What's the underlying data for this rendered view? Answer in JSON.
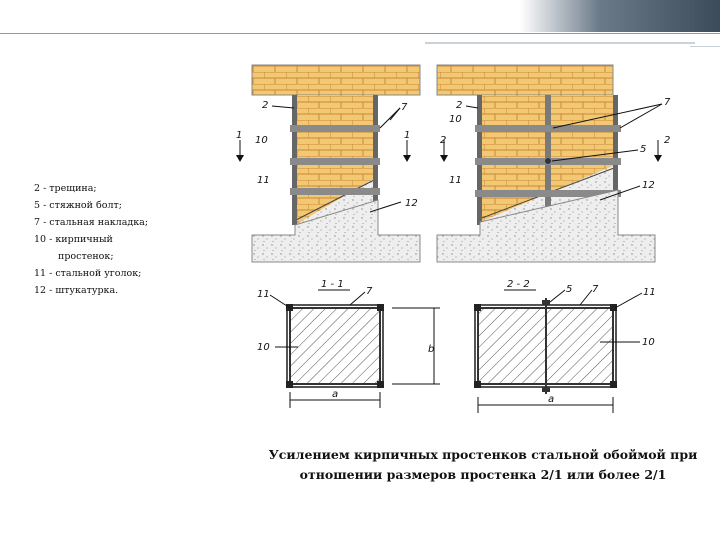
{
  "legend": [
    {
      "num": "2",
      "text": "2 - трещина;"
    },
    {
      "num": "5",
      "text": "5 - стяжной болт;"
    },
    {
      "num": "7",
      "text": "7 - стальная накладка;"
    },
    {
      "num": "10",
      "text": "10 - кирпичный",
      "cont": "простенок;"
    },
    {
      "num": "11",
      "text": "11 - стальной уголок;"
    },
    {
      "num": "12",
      "text": "12 - штукатурка."
    }
  ],
  "caption": {
    "line1": "Усилением кирпичных простенков стальной обоймой при",
    "line2": "отношении размеров простенка 2/1 или более 2/1"
  },
  "diagram": {
    "labels": {
      "l1": "1",
      "l2": "2",
      "l5": "5",
      "l7": "7",
      "l10": "10",
      "l11": "11",
      "l12": "12",
      "sec11": "1 - 1",
      "sec22": "2 - 2",
      "a": "a",
      "b": "b"
    }
  }
}
